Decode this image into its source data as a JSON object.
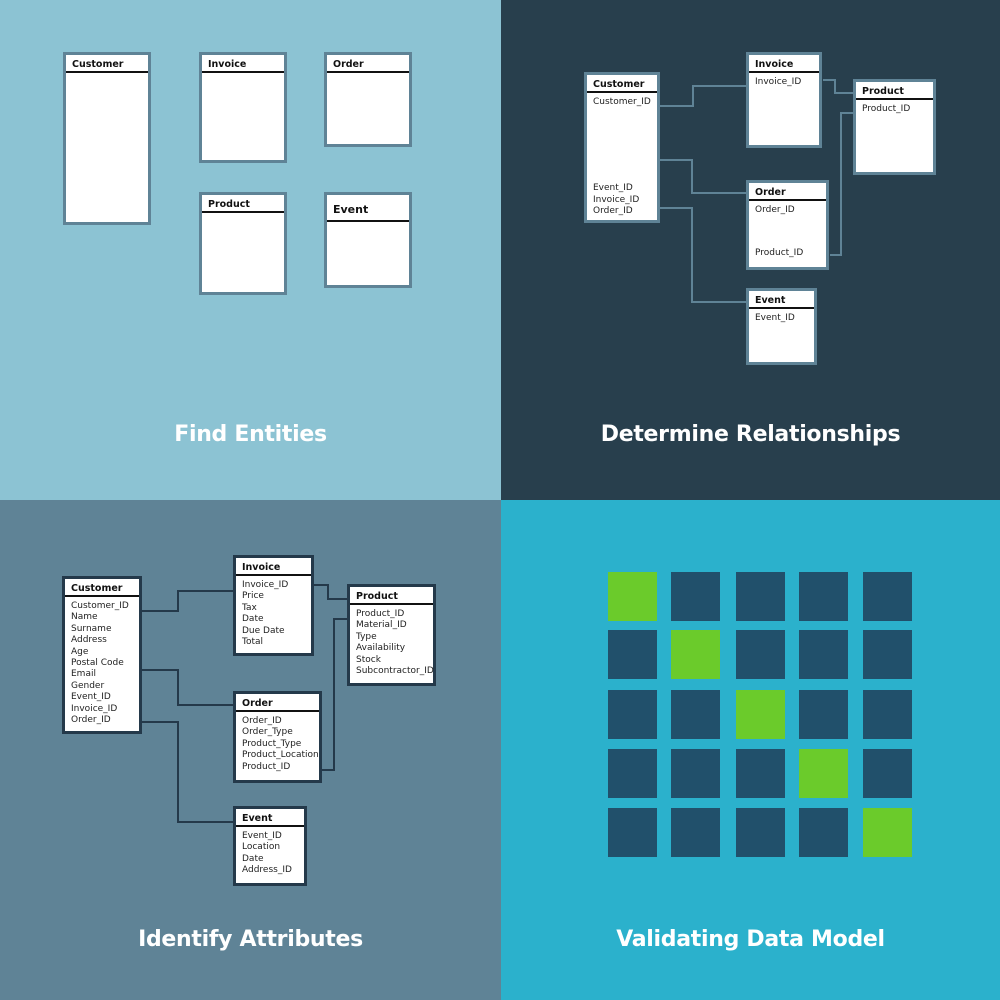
{
  "steps": [
    {
      "title": "Find Entities",
      "entities": [
        {
          "name": "Customer",
          "attributes": []
        },
        {
          "name": "Invoice",
          "attributes": []
        },
        {
          "name": "Order",
          "attributes": []
        },
        {
          "name": "Product",
          "attributes": []
        },
        {
          "name": "Event",
          "attributes": []
        }
      ]
    },
    {
      "title": "Determine Relationships",
      "entities": [
        {
          "name": "Customer",
          "attributes": [
            "Customer_ID",
            "Event_ID",
            "Invoice_ID",
            "Order_ID"
          ]
        },
        {
          "name": "Invoice",
          "attributes": [
            "Invoice_ID"
          ]
        },
        {
          "name": "Product",
          "attributes": [
            "Product_ID"
          ]
        },
        {
          "name": "Order",
          "attributes": [
            "Order_ID",
            "Product_ID"
          ]
        },
        {
          "name": "Event",
          "attributes": [
            "Event_ID"
          ]
        }
      ],
      "relationships": [
        {
          "from": "Customer.Customer_ID",
          "to": "Invoice"
        },
        {
          "from": "Customer",
          "to": "Order"
        },
        {
          "from": "Customer.Order_ID",
          "to": "Event"
        },
        {
          "from": "Invoice",
          "to": "Product"
        },
        {
          "from": "Order.Product_ID",
          "to": "Product"
        }
      ]
    },
    {
      "title": "Identify Attributes",
      "entities": [
        {
          "name": "Customer",
          "attributes": [
            "Customer_ID",
            "Name",
            "Surname",
            "Address",
            "Age",
            "Postal Code",
            "Email",
            "Gender",
            "Event_ID",
            "Invoice_ID",
            "Order_ID"
          ]
        },
        {
          "name": "Invoice",
          "attributes": [
            "Invoice_ID",
            "Price",
            "Tax",
            "Date",
            "Due Date",
            "Total"
          ]
        },
        {
          "name": "Product",
          "attributes": [
            "Product_ID",
            "Material_ID",
            "Type",
            "Availability",
            "Stock",
            "Subcontractor_ID"
          ]
        },
        {
          "name": "Order",
          "attributes": [
            "Order_ID",
            "Order_Type",
            "Product_Type",
            "Product_Location",
            "Product_ID"
          ]
        },
        {
          "name": "Event",
          "attributes": [
            "Event_ID",
            "Location",
            "Date",
            "Address_ID"
          ]
        }
      ]
    },
    {
      "title": "Validating Data Model",
      "grid": {
        "rows": 5,
        "cols": 5,
        "highlighted": [
          [
            0,
            0
          ],
          [
            1,
            1
          ],
          [
            2,
            2
          ],
          [
            3,
            3
          ],
          [
            4,
            4
          ]
        ],
        "colors": {
          "default": "#21506b",
          "highlight": "#6bcb2b"
        }
      }
    }
  ]
}
